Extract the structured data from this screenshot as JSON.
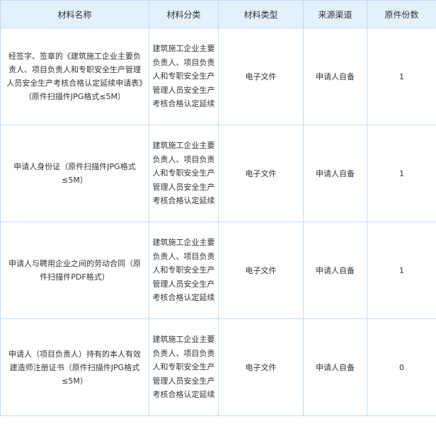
{
  "table": {
    "headers": [
      "材料名称",
      "材料分类",
      "材料类型",
      "来源渠道",
      "原件份数"
    ],
    "rows": [
      {
        "name": "经签字、签章的《建筑施工企业主要负责人、项目负责人和专职安全生产管理人员安全生产考核合格认定延续申请表》（原件扫描件JPG格式≤5M）",
        "category": "建筑施工企业主要负责人、项目负责人和专职安全生产管理人员安全生产考核合格认定延续",
        "type": "电子文件",
        "source": "申请人自备",
        "count": "1"
      },
      {
        "name": "申请人身份证（原件扫描件JPG格式≤5M）",
        "category": "建筑施工企业主要负责人、项目负责人和专职安全生产管理人员安全生产考核合格认定延续",
        "type": "电子文件",
        "source": "申请人自备",
        "count": "1"
      },
      {
        "name": "申请人与聘用企业之间的劳动合同（原件扫描件PDF格式）",
        "category": "建筑施工企业主要负责人、项目负责人和专职安全生产管理人员安全生产考核合格认定延续",
        "type": "电子文件",
        "source": "申请人自备",
        "count": "1"
      },
      {
        "name": "申请人（项目负责人）持有的本人有效建造师注册证书（原件扫描件JPG格式≤5M）",
        "category": "建筑施工企业主要负责人、项目负责人和专职安全生产管理人员安全生产考核合格认定延续",
        "type": "电子文件",
        "source": "申请人自备",
        "count": "0"
      }
    ]
  }
}
